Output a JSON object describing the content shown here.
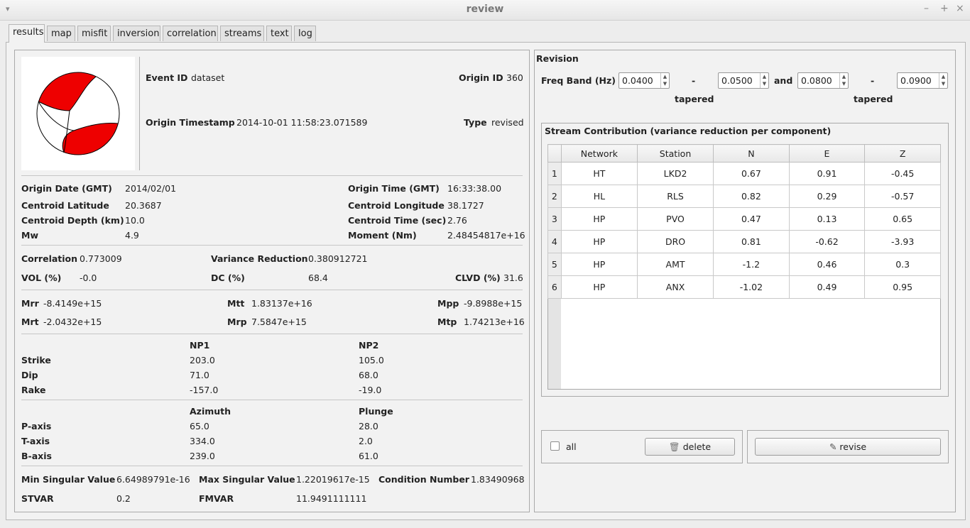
{
  "window": {
    "title": "review"
  },
  "tabs": [
    "results",
    "map",
    "misfit",
    "inversion",
    "correlation",
    "streams",
    "text",
    "log"
  ],
  "event": {
    "event_id_label": "Event ID",
    "event_id": "dataset",
    "origin_id_label": "Origin ID",
    "origin_id": "360",
    "origin_ts_label": "Origin Timestamp",
    "origin_ts": "2014-10-01 11:58:23.071589",
    "type_label": "Type",
    "type": "revised"
  },
  "origin": {
    "date_label": "Origin Date (GMT)",
    "date": "2014/02/01",
    "time_label": "Origin Time (GMT)",
    "time": "16:33:38.00",
    "lat_label": "Centroid Latitude",
    "lat": "20.3687",
    "lon_label": "Centroid Longitude",
    "lon": "38.1727",
    "depth_label": "Centroid Depth (km)",
    "depth": "10.0",
    "ctime_label": "Centroid Time (sec)",
    "ctime": "2.76",
    "mw_label": "Mw",
    "mw": "4.9",
    "moment_label": "Moment (Nm)",
    "moment": "2.48454817e+16"
  },
  "stats": {
    "corr_label": "Correlation",
    "corr": "0.773009",
    "vr_label": "Variance Reduction",
    "vr": "0.380912721",
    "vol_label": "VOL (%)",
    "vol": "-0.0",
    "dc_label": "DC (%)",
    "dc": "68.4",
    "clvd_label": "CLVD (%)",
    "clvd": "31.6"
  },
  "tensor": {
    "mrr_label": "Mrr",
    "mrr": "-8.4149e+15",
    "mtt_label": "Mtt",
    "mtt": "1.83137e+16",
    "mpp_label": "Mpp",
    "mpp": "-9.8988e+15",
    "mrt_label": "Mrt",
    "mrt": "-2.0432e+15",
    "mrp_label": "Mrp",
    "mrp": "7.5847e+15",
    "mtp_label": "Mtp",
    "mtp": "1.74213e+16"
  },
  "planes": {
    "np1_label": "NP1",
    "np2_label": "NP2",
    "strike_label": "Strike",
    "dip_label": "Dip",
    "rake_label": "Rake",
    "np1": {
      "strike": "203.0",
      "dip": "71.0",
      "rake": "-157.0"
    },
    "np2": {
      "strike": "105.0",
      "dip": "68.0",
      "rake": "-19.0"
    }
  },
  "axes": {
    "azimuth_label": "Azimuth",
    "plunge_label": "Plunge",
    "p_label": "P-axis",
    "t_label": "T-axis",
    "b_label": "B-axis",
    "p": {
      "az": "65.0",
      "pl": "28.0"
    },
    "t": {
      "az": "334.0",
      "pl": "2.0"
    },
    "b": {
      "az": "239.0",
      "pl": "61.0"
    }
  },
  "singular": {
    "min_label": "Min Singular Value",
    "min": "6.64989791e-16",
    "max_label": "Max Singular Value",
    "max": "1.22019617e-15",
    "cond_label": "Condition Number",
    "cond": "1.83490968",
    "stvar_label": "STVAR",
    "stvar": "0.2",
    "fmvar_label": "FMVAR",
    "fmvar": "11.9491111111"
  },
  "revision": {
    "title": "Revision",
    "freq_label": "Freq Band (Hz)",
    "f1": "0.0400",
    "dash1": "-",
    "f2": "0.0500",
    "and_label": "and",
    "f3": "0.0800",
    "dash2": "-",
    "f4": "0.0900",
    "tapered1": "tapered",
    "tapered2": "tapered"
  },
  "streams": {
    "title": "Stream Contribution (variance reduction per component)",
    "headers": [
      "Network",
      "Station",
      "N",
      "E",
      "Z"
    ],
    "rows": [
      [
        "1",
        "HT",
        "LKD2",
        "0.67",
        "0.91",
        "-0.45"
      ],
      [
        "2",
        "HL",
        "RLS",
        "0.82",
        "0.29",
        "-0.57"
      ],
      [
        "3",
        "HP",
        "PVO",
        "0.47",
        "0.13",
        "0.65"
      ],
      [
        "4",
        "HP",
        "DRO",
        "0.81",
        "-0.62",
        "-3.93"
      ],
      [
        "5",
        "HP",
        "AMT",
        "-1.2",
        "0.46",
        "0.3"
      ],
      [
        "6",
        "HP",
        "ANX",
        "-1.02",
        "0.49",
        "0.95"
      ]
    ]
  },
  "actions": {
    "all_label": "all",
    "delete_label": "delete",
    "revise_label": "revise"
  },
  "colors": {
    "beachball_fill": "#ee0000"
  }
}
